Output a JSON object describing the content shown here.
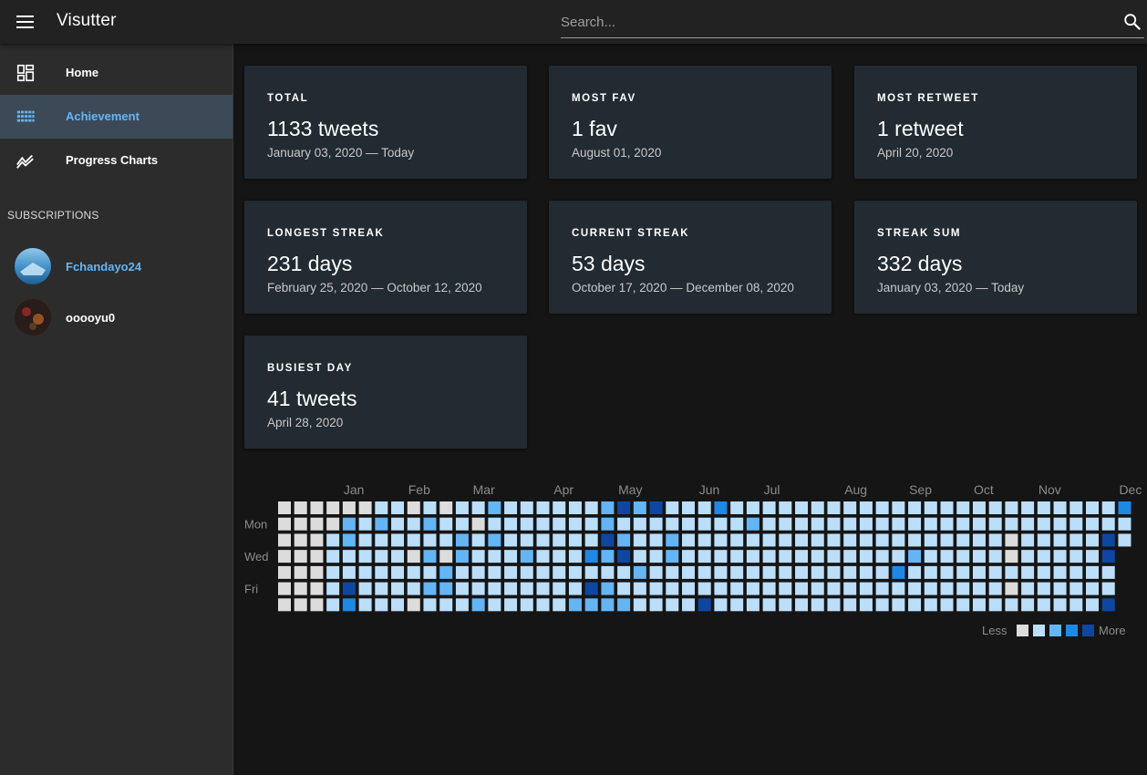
{
  "app": {
    "title": "Visutter"
  },
  "search": {
    "placeholder": "Search..."
  },
  "sidebar": {
    "items": [
      {
        "label": "Home",
        "icon": "dashboard-icon",
        "active": false
      },
      {
        "label": "Achievement",
        "icon": "grid-icon",
        "active": true
      },
      {
        "label": "Progress Charts",
        "icon": "trending-icon",
        "active": false
      }
    ],
    "subscriptions_header": "SUBSCRIPTIONS",
    "subscriptions": [
      {
        "name": "Fchandayo24",
        "highlighted": true
      },
      {
        "name": "ooooyu0",
        "highlighted": false
      }
    ]
  },
  "cards": [
    {
      "label": "TOTAL",
      "value": "1133 tweets",
      "sub": "January 03, 2020 — Today"
    },
    {
      "label": "MOST FAV",
      "value": "1 fav",
      "sub": "August 01, 2020"
    },
    {
      "label": "MOST RETWEET",
      "value": "1 retweet",
      "sub": "April 20, 2020"
    },
    {
      "label": "LONGEST STREAK",
      "value": "231 days",
      "sub": "February 25, 2020 — October 12, 2020"
    },
    {
      "label": "CURRENT STREAK",
      "value": "53 days",
      "sub": "October 17, 2020 — December 08, 2020"
    },
    {
      "label": "STREAK SUM",
      "value": "332 days",
      "sub": "January 03, 2020 — Today"
    },
    {
      "label": "BUSIEST DAY",
      "value": "41 tweets",
      "sub": "April 28, 2020"
    }
  ],
  "heatmap": {
    "months": [
      "Jan",
      "Feb",
      "Mar",
      "Apr",
      "May",
      "Jun",
      "Jul",
      "Aug",
      "Sep",
      "Oct",
      "Nov",
      "Dec"
    ],
    "month_week_index": [
      4,
      8,
      12,
      17,
      21,
      26,
      30,
      35,
      39,
      43,
      47,
      52
    ],
    "weekday_labels": [
      "",
      "Mon",
      "",
      "Wed",
      "",
      "Fri",
      ""
    ],
    "legend_less": "Less",
    "legend_more": "More",
    "level_colors": [
      "#dcdcdc",
      "#bbdefb",
      "#64b5f6",
      "#1e88e5",
      "#0d47a1"
    ],
    "weeks": [
      [
        0,
        0,
        0,
        0,
        0,
        0,
        0
      ],
      [
        0,
        0,
        0,
        0,
        0,
        0,
        0
      ],
      [
        0,
        0,
        0,
        0,
        0,
        0,
        0
      ],
      [
        0,
        0,
        1,
        1,
        1,
        1,
        1
      ],
      [
        0,
        2,
        2,
        1,
        1,
        4,
        3
      ],
      [
        0,
        1,
        1,
        1,
        1,
        1,
        1
      ],
      [
        1,
        2,
        1,
        1,
        1,
        1,
        1
      ],
      [
        1,
        1,
        1,
        1,
        1,
        1,
        1
      ],
      [
        0,
        1,
        1,
        0,
        1,
        1,
        0
      ],
      [
        1,
        2,
        1,
        2,
        1,
        2,
        1
      ],
      [
        0,
        1,
        1,
        0,
        2,
        2,
        1
      ],
      [
        1,
        1,
        2,
        2,
        1,
        1,
        1
      ],
      [
        1,
        0,
        1,
        1,
        1,
        1,
        2
      ],
      [
        2,
        1,
        2,
        1,
        1,
        1,
        1
      ],
      [
        1,
        1,
        1,
        1,
        1,
        1,
        1
      ],
      [
        1,
        1,
        1,
        2,
        1,
        1,
        1
      ],
      [
        1,
        1,
        1,
        1,
        1,
        1,
        1
      ],
      [
        1,
        1,
        1,
        1,
        1,
        1,
        1
      ],
      [
        1,
        1,
        1,
        1,
        1,
        1,
        2
      ],
      [
        1,
        1,
        1,
        3,
        1,
        4,
        2
      ],
      [
        2,
        2,
        4,
        2,
        1,
        2,
        2
      ],
      [
        4,
        1,
        2,
        4,
        1,
        1,
        2
      ],
      [
        2,
        1,
        1,
        1,
        2,
        1,
        1
      ],
      [
        4,
        1,
        1,
        1,
        1,
        1,
        1
      ],
      [
        1,
        1,
        2,
        2,
        1,
        1,
        1
      ],
      [
        1,
        1,
        1,
        1,
        1,
        1,
        1
      ],
      [
        1,
        1,
        1,
        1,
        1,
        1,
        4
      ],
      [
        3,
        1,
        1,
        1,
        1,
        1,
        1
      ],
      [
        1,
        1,
        1,
        1,
        1,
        1,
        1
      ],
      [
        1,
        2,
        1,
        1,
        1,
        1,
        1
      ],
      [
        1,
        1,
        1,
        1,
        1,
        1,
        1
      ],
      [
        1,
        1,
        1,
        1,
        1,
        1,
        1
      ],
      [
        1,
        1,
        1,
        1,
        1,
        1,
        1
      ],
      [
        1,
        1,
        1,
        1,
        1,
        1,
        1
      ],
      [
        1,
        1,
        1,
        1,
        1,
        1,
        1
      ],
      [
        1,
        1,
        1,
        1,
        1,
        1,
        1
      ],
      [
        1,
        1,
        1,
        1,
        1,
        1,
        1
      ],
      [
        1,
        1,
        1,
        1,
        1,
        1,
        1
      ],
      [
        1,
        1,
        1,
        1,
        3,
        1,
        1
      ],
      [
        1,
        1,
        1,
        2,
        1,
        1,
        1
      ],
      [
        1,
        1,
        1,
        1,
        1,
        1,
        1
      ],
      [
        1,
        1,
        1,
        1,
        1,
        1,
        1
      ],
      [
        1,
        1,
        1,
        1,
        1,
        1,
        1
      ],
      [
        1,
        1,
        1,
        1,
        1,
        1,
        1
      ],
      [
        1,
        1,
        1,
        1,
        1,
        1,
        1
      ],
      [
        1,
        1,
        0,
        0,
        1,
        0,
        1
      ],
      [
        1,
        1,
        1,
        1,
        1,
        1,
        1
      ],
      [
        1,
        1,
        1,
        1,
        1,
        1,
        1
      ],
      [
        1,
        1,
        1,
        1,
        1,
        1,
        1
      ],
      [
        1,
        1,
        1,
        1,
        1,
        1,
        1
      ],
      [
        1,
        1,
        1,
        1,
        1,
        1,
        1
      ],
      [
        1,
        1,
        4,
        4,
        1,
        1,
        4
      ],
      [
        3,
        1,
        1
      ]
    ]
  }
}
